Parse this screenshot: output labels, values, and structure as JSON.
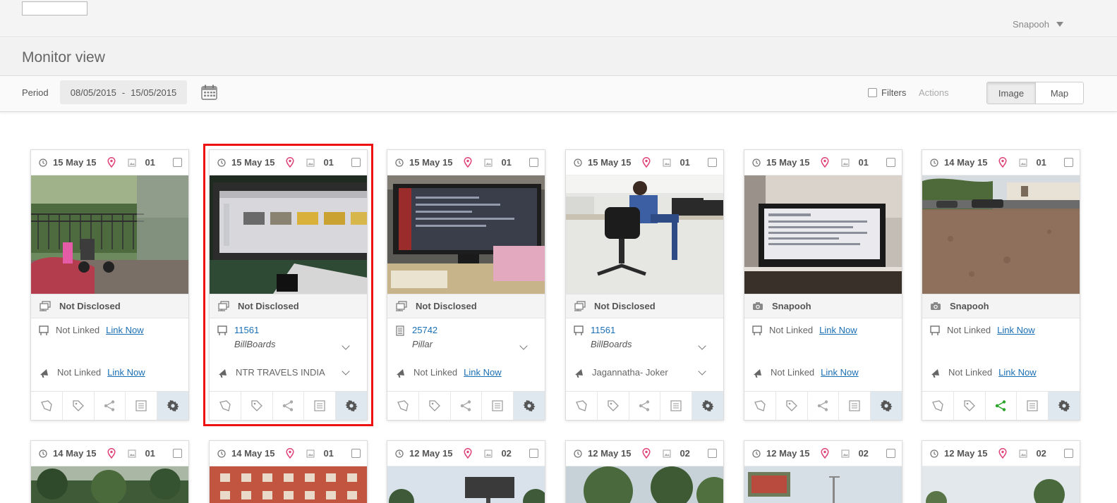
{
  "header": {
    "logo_alt": "",
    "user": "Snapooh"
  },
  "page": {
    "title": "Monitor view"
  },
  "toolbar": {
    "period_label": "Period",
    "date_from": "08/05/2015",
    "date_sep": "-",
    "date_to": "15/05/2015",
    "filters_label": "Filters",
    "actions_label": "Actions",
    "view_image": "Image",
    "view_map": "Map"
  },
  "cards": [
    {
      "date": "15 May 15",
      "count": "01",
      "owner": "Not Disclosed",
      "site_label": "Not Linked",
      "site_link": "Link Now",
      "campaign_label": "Not Linked",
      "campaign_link": "Link Now"
    },
    {
      "date": "15 May 15",
      "count": "01",
      "owner": "Not Disclosed",
      "site_code": "11561",
      "site_type": "BillBoards",
      "campaign_name": "NTR TRAVELS INDIA"
    },
    {
      "date": "15 May 15",
      "count": "01",
      "owner": "Not Disclosed",
      "site_code": "25742",
      "site_type": "Pillar",
      "campaign_label": "Not Linked",
      "campaign_link": "Link Now"
    },
    {
      "date": "15 May 15",
      "count": "01",
      "owner": "Not Disclosed",
      "site_code": "11561",
      "site_type": "BillBoards",
      "campaign_name": "Jagannatha- Joker"
    },
    {
      "date": "15 May 15",
      "count": "01",
      "owner": "Snapooh",
      "site_label": "Not Linked",
      "site_link": "Link Now",
      "campaign_label": "Not Linked",
      "campaign_link": "Link Now"
    },
    {
      "date": "14 May 15",
      "count": "01",
      "owner": "Snapooh",
      "site_label": "Not Linked",
      "site_link": "Link Now",
      "campaign_label": "Not Linked",
      "campaign_link": "Link Now"
    }
  ],
  "cards_row2": [
    {
      "date": "14 May 15",
      "count": "01"
    },
    {
      "date": "14 May 15",
      "count": "01"
    },
    {
      "date": "12 May 15",
      "count": "02"
    },
    {
      "date": "12 May 15",
      "count": "02"
    },
    {
      "date": "12 May 15",
      "count": "02"
    },
    {
      "date": "12 May 15",
      "count": "02"
    }
  ],
  "colors": {
    "accent_link": "#1b6fb4",
    "pin": "#e0457b",
    "selected_outline": "#e11111",
    "share_active": "#2aa52a"
  }
}
